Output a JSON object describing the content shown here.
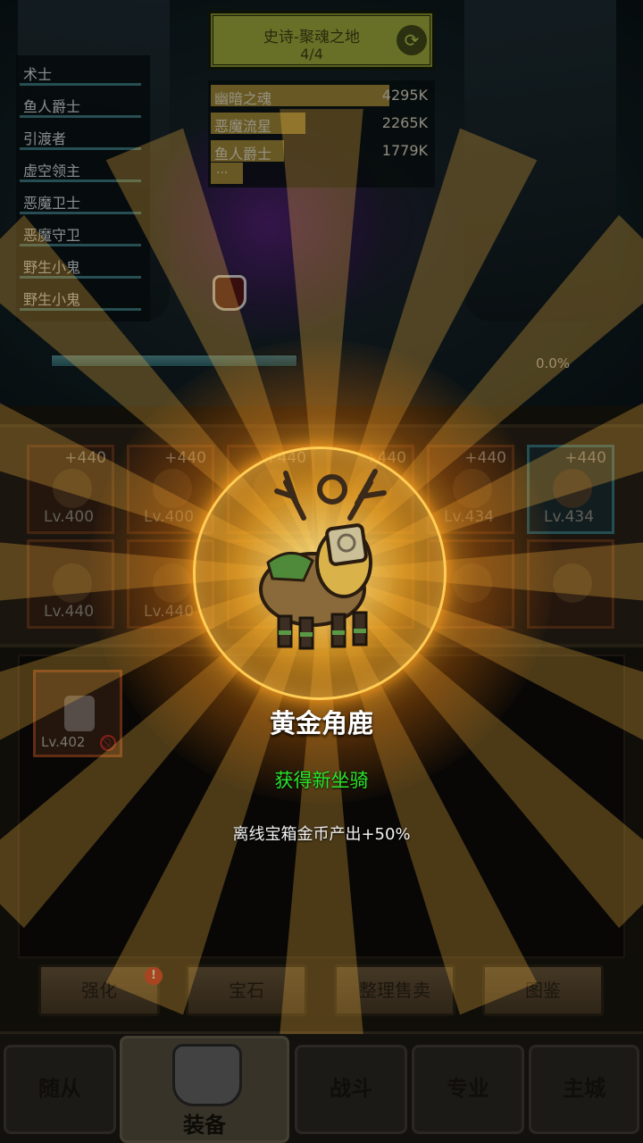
{
  "stage": {
    "title": "史诗-聚魂之地",
    "progress": "4/4",
    "refresh_icon": "refresh-icon"
  },
  "enemies": [
    "术士",
    "鱼人爵士",
    "引渡者",
    "虚空领主",
    "恶魔卫士",
    "恶魔守卫",
    "野生小鬼",
    "野生小鬼"
  ],
  "damage": [
    {
      "name": "幽暗之魂",
      "value": "4295K",
      "share": 1.0
    },
    {
      "name": "恶魔流星",
      "value": "2265K",
      "share": 0.53
    },
    {
      "name": "鱼人爵士",
      "value": "1779K",
      "share": 0.41
    }
  ],
  "damage_more": "...",
  "wave": {
    "percent": "0.0%",
    "fill": 1.0
  },
  "equipment": [
    {
      "bonus": "+440",
      "level": "Lv.400",
      "frame": "orange"
    },
    {
      "bonus": "+440",
      "level": "Lv.400",
      "frame": "orange"
    },
    {
      "bonus": "+440",
      "level": "",
      "frame": "orange"
    },
    {
      "bonus": "+440",
      "level": "",
      "frame": "orange"
    },
    {
      "bonus": "+440",
      "level": "Lv.434",
      "frame": "orange"
    },
    {
      "bonus": "+440",
      "level": "Lv.434",
      "frame": "teal"
    },
    {
      "bonus": "",
      "level": "Lv.440",
      "frame": "orange"
    },
    {
      "bonus": "",
      "level": "Lv.440",
      "frame": "orange"
    },
    {
      "bonus": "",
      "level": "",
      "frame": "orange"
    },
    {
      "bonus": "",
      "level": "",
      "frame": "orange"
    },
    {
      "bonus": "",
      "level": "",
      "frame": "orange"
    },
    {
      "bonus": "",
      "level": "",
      "frame": "orange"
    }
  ],
  "bag_item": {
    "level": "Lv.402",
    "locked": true
  },
  "actions": {
    "enhance": "强化",
    "gem": "宝石",
    "sort_sell": "整理售卖",
    "codex": "图鉴",
    "enhance_alert": "!"
  },
  "nav": {
    "followers": "随从",
    "equipment": "装备",
    "battle": "战斗",
    "profession": "专业",
    "main_city": "主城",
    "active": "equipment"
  },
  "reward": {
    "name": "黄金角鹿",
    "status": "获得新坐骑",
    "effect": "离线宝箱金币产出+50%"
  },
  "colors": {
    "accent_gold": "#ffcc55",
    "status_green": "#27e62b",
    "slot_orange": "#6d3d1e",
    "slot_teal": "#3d7f88"
  }
}
